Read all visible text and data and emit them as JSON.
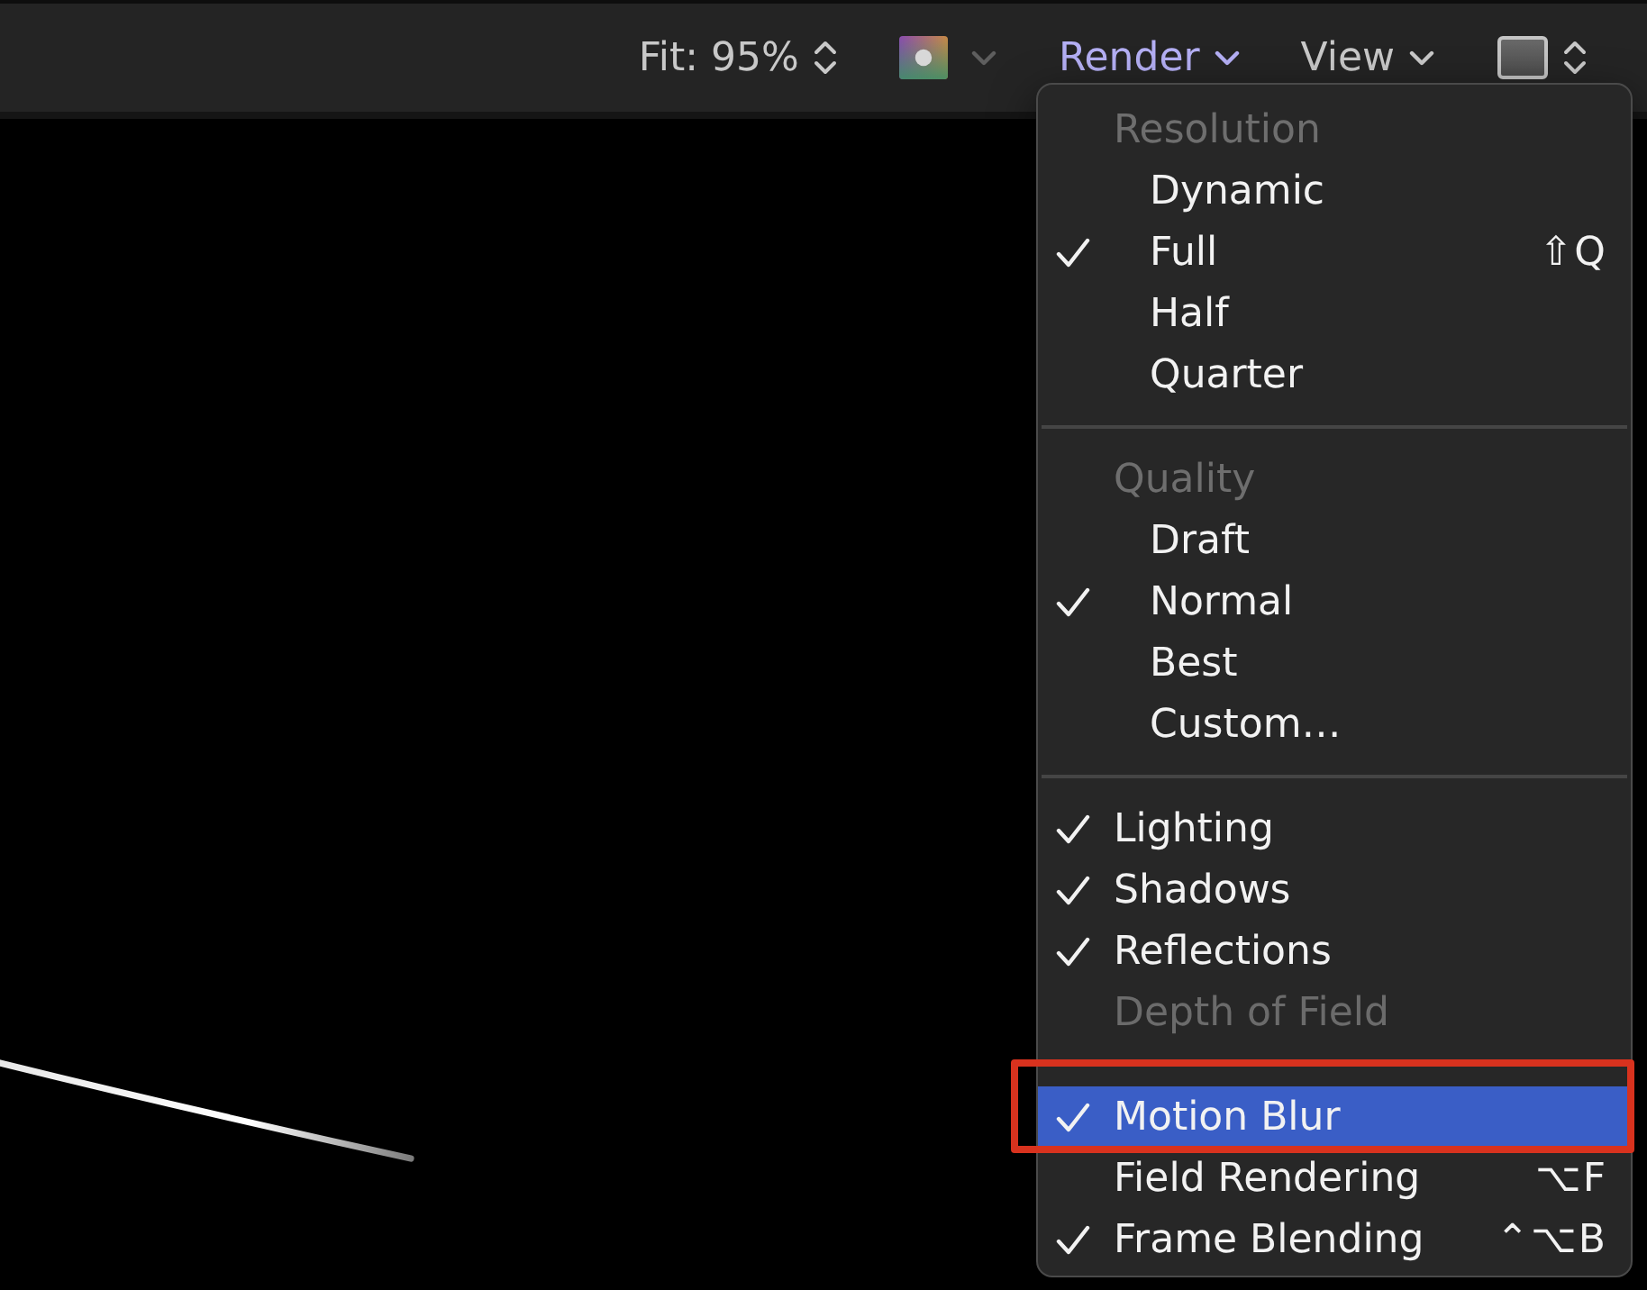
{
  "toolbar": {
    "zoom": {
      "label": "Fit: 95%"
    },
    "menus": [
      {
        "label": "Render",
        "open": true
      },
      {
        "label": "View",
        "open": false
      }
    ]
  },
  "render_menu": {
    "sections": [
      {
        "header": "Resolution",
        "items": [
          {
            "label": "Dynamic",
            "checked": false,
            "disabled": false,
            "highlighted": false,
            "annotated": false
          },
          {
            "label": "Full",
            "checked": true,
            "disabled": false,
            "highlighted": false,
            "annotated": false,
            "shortcut": "⇧Q"
          },
          {
            "label": "Half",
            "checked": false,
            "disabled": false,
            "highlighted": false,
            "annotated": false
          },
          {
            "label": "Quarter",
            "checked": false,
            "disabled": false,
            "highlighted": false,
            "annotated": false
          }
        ]
      },
      {
        "header": "Quality",
        "items": [
          {
            "label": "Draft",
            "checked": false,
            "disabled": false,
            "highlighted": false,
            "annotated": false
          },
          {
            "label": "Normal",
            "checked": true,
            "disabled": false,
            "highlighted": false,
            "annotated": false
          },
          {
            "label": "Best",
            "checked": false,
            "disabled": false,
            "highlighted": false,
            "annotated": false
          },
          {
            "label": "Custom…",
            "checked": false,
            "disabled": false,
            "highlighted": false,
            "annotated": false
          }
        ]
      },
      {
        "items": [
          {
            "label": "Lighting",
            "checked": true,
            "disabled": false,
            "highlighted": false,
            "annotated": false
          },
          {
            "label": "Shadows",
            "checked": true,
            "disabled": false,
            "highlighted": false,
            "annotated": false
          },
          {
            "label": "Reflections",
            "checked": true,
            "disabled": false,
            "highlighted": false,
            "annotated": false
          },
          {
            "label": "Depth of Field",
            "checked": false,
            "disabled": true,
            "highlighted": false,
            "annotated": false
          }
        ]
      },
      {
        "items": [
          {
            "label": "Motion Blur",
            "checked": true,
            "disabled": false,
            "highlighted": true,
            "annotated": true
          },
          {
            "label": "Field Rendering",
            "checked": false,
            "disabled": false,
            "highlighted": false,
            "annotated": false,
            "shortcut": "⌥F"
          },
          {
            "label": "Frame Blending",
            "checked": true,
            "disabled": false,
            "highlighted": false,
            "annotated": false,
            "shortcut": "⌃⌥B"
          }
        ]
      }
    ]
  }
}
